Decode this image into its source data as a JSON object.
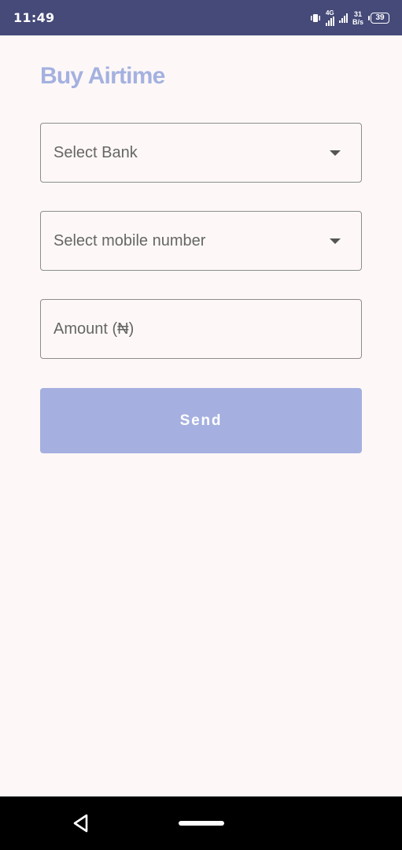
{
  "status_bar": {
    "time": "11:49",
    "network_type": "4G",
    "speed_value": "31",
    "speed_unit": "B/s",
    "battery_level": "39"
  },
  "page": {
    "title": "Buy Airtime"
  },
  "form": {
    "bank_select": {
      "placeholder": "Select Bank"
    },
    "mobile_select": {
      "placeholder": "Select mobile number"
    },
    "amount_input": {
      "placeholder": "Amount (₦)"
    },
    "send_label": "Send"
  },
  "colors": {
    "status_bar_bg": "#454a78",
    "title_accent": "#a4b1e0",
    "button_bg": "#a5b0e0",
    "page_bg": "#fdf8f7"
  },
  "icons": {
    "vibrate": "vibrate-icon",
    "signal": "signal-icon",
    "battery": "battery-icon",
    "dropdown": "chevron-down-icon",
    "back": "back-icon",
    "home": "home-pill"
  }
}
